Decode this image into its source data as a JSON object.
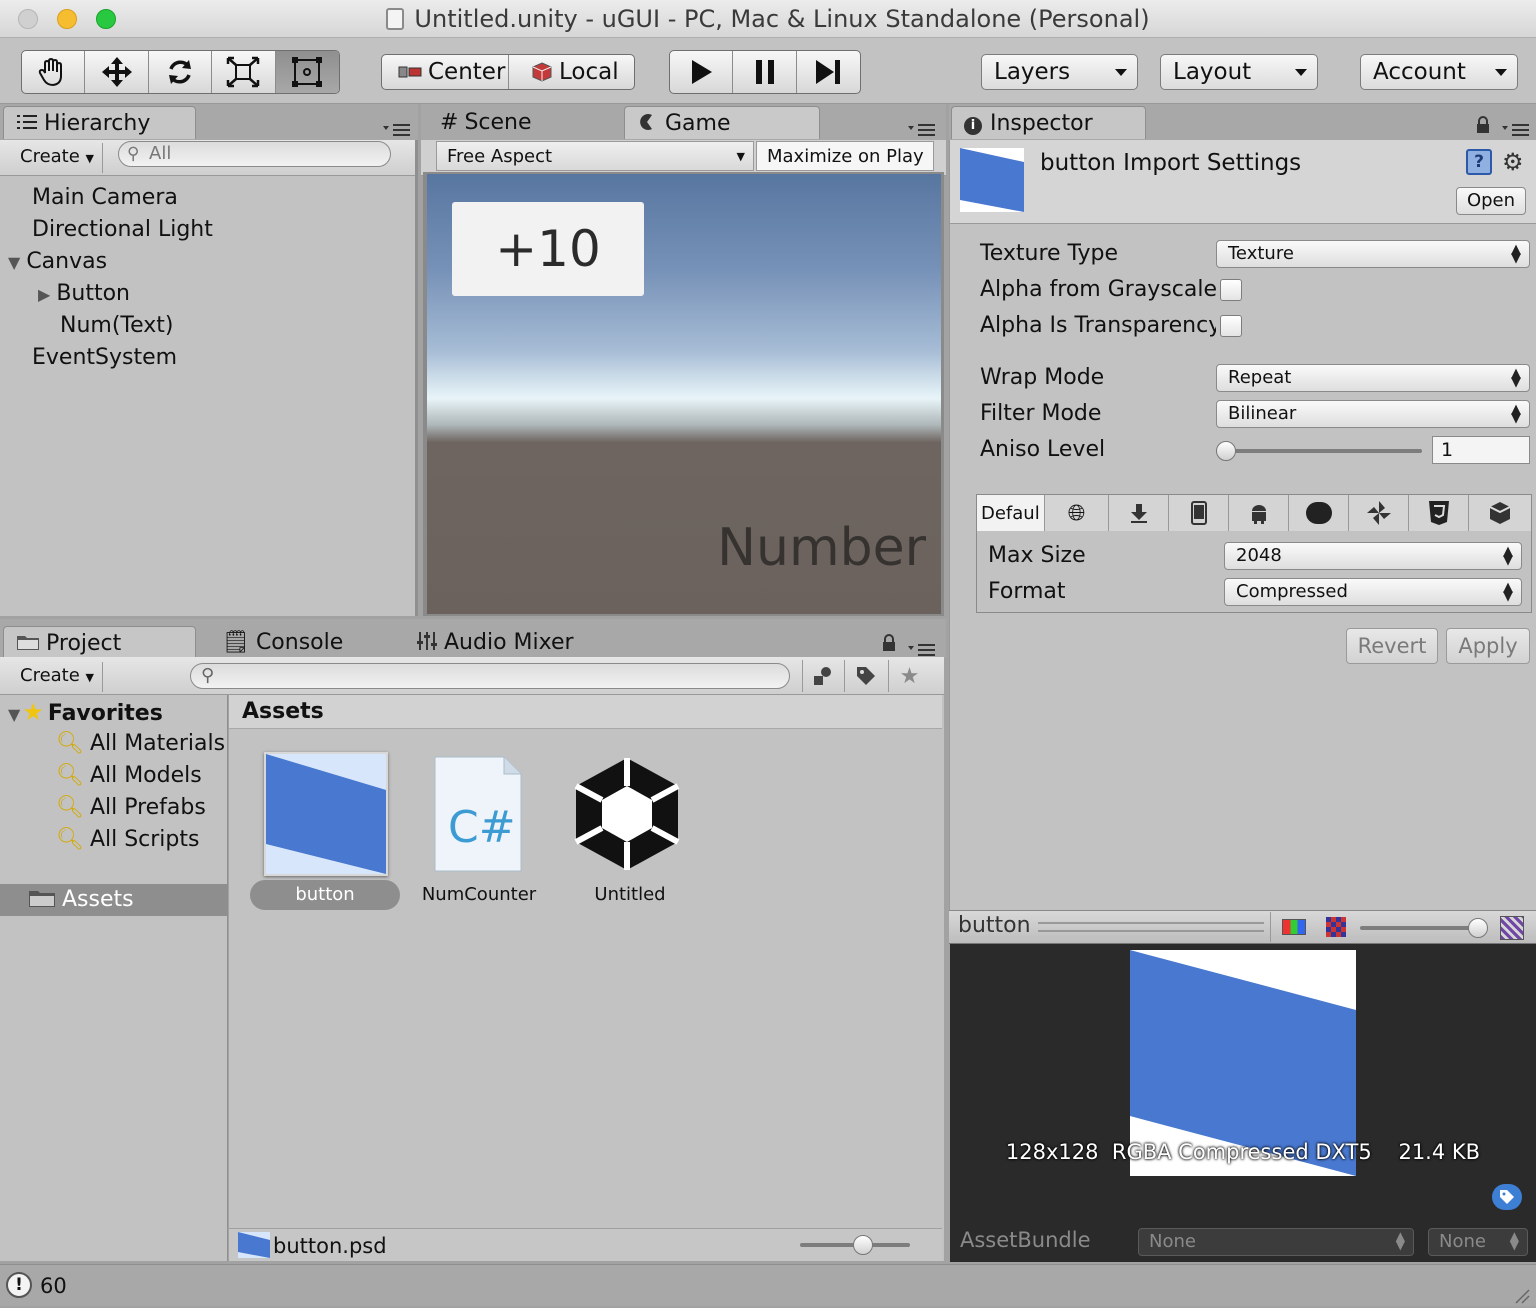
{
  "window": {
    "title": "Untitled.unity - uGUI - PC, Mac & Linux Standalone (Personal)"
  },
  "toolbar": {
    "pivot_label": "Center",
    "space_label": "Local",
    "layers_label": "Layers",
    "layout_label": "Layout",
    "account_label": "Account"
  },
  "hierarchy": {
    "tab_label": "Hierarchy",
    "create_label": "Create",
    "search_placeholder": "All",
    "items": [
      "Main Camera",
      "Directional Light",
      "Canvas",
      "Button",
      "Num(Text)",
      "EventSystem"
    ]
  },
  "scene_tab": {
    "label": "Scene"
  },
  "game": {
    "tab_label": "Game",
    "aspect_label": "Free Aspect",
    "maximize_label": "Maximize on Play",
    "button_text": "+10",
    "number_text": "Number"
  },
  "project": {
    "tab_label": "Project",
    "console_tab_label": "Console",
    "audio_mixer_tab_label": "Audio Mixer",
    "create_label": "Create",
    "favorites_label": "Favorites",
    "favorites": [
      "All Materials",
      "All Models",
      "All Prefabs",
      "All Scripts"
    ],
    "assets_folder_label": "Assets",
    "assets_header": "Assets",
    "assets": [
      "button",
      "NumCounter",
      "Untitled"
    ],
    "csharp_glyph": "C#",
    "selected_path": "button.psd"
  },
  "inspector": {
    "tab_label": "Inspector",
    "title": "button Import Settings",
    "open_label": "Open",
    "texture_type_label": "Texture Type",
    "texture_type_value": "Texture",
    "alpha_gray_label": "Alpha from Grayscale",
    "alpha_transp_label": "Alpha Is Transparency",
    "wrap_mode_label": "Wrap Mode",
    "wrap_mode_value": "Repeat",
    "filter_mode_label": "Filter Mode",
    "filter_mode_value": "Bilinear",
    "aniso_label": "Aniso Level",
    "aniso_value": "1",
    "aniso_slider_fraction": 0.0,
    "platform_default_label": "Defaul",
    "max_size_label": "Max Size",
    "max_size_value": "2048",
    "format_label": "Format",
    "format_value": "Compressed",
    "revert_label": "Revert",
    "apply_label": "Apply"
  },
  "preview": {
    "name": "button",
    "info_size": "128x128",
    "info_format": "RGBA Compressed DXT5",
    "info_kb": "21.4 KB",
    "assetbundle_label": "AssetBundle",
    "assetbundle_value": "None",
    "variant_value": "None"
  },
  "statusbar": {
    "text": "60"
  },
  "colors": {
    "accent_blue": "#4878d0",
    "selection_gray": "#8e8e8e"
  }
}
